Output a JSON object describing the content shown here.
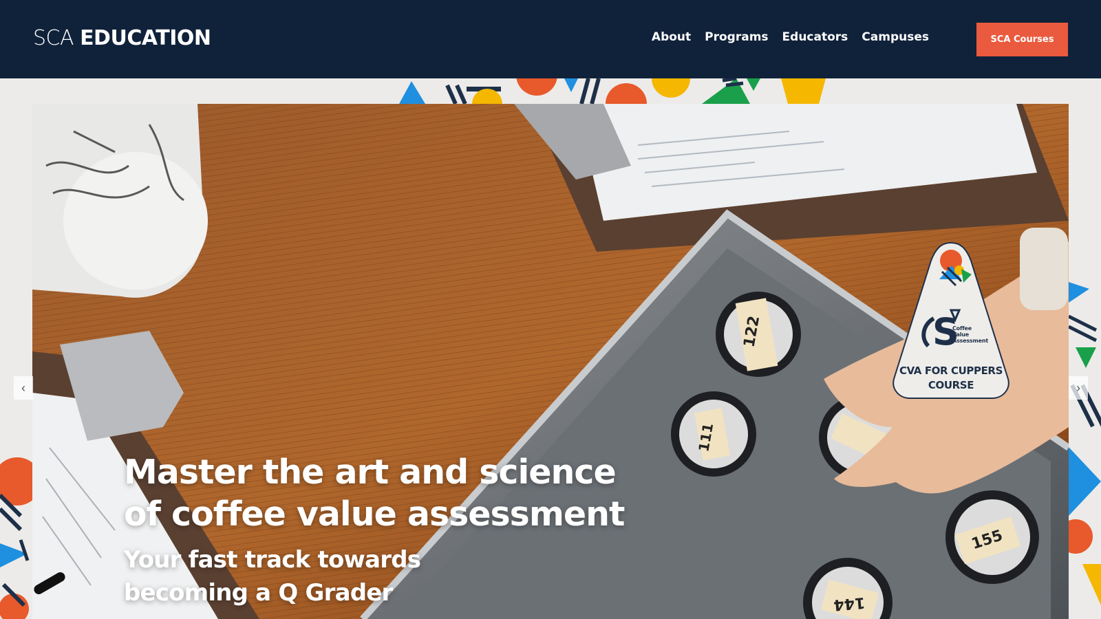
{
  "brand": {
    "logo_light": "SCA ",
    "logo_bold": "EDUCATION"
  },
  "nav": {
    "items": [
      "About",
      "Programs",
      "Educators",
      "Campuses"
    ],
    "cta_label": "SCA Courses"
  },
  "hero": {
    "headline_line1": "Master the art and science",
    "headline_line2": "of coffee value assessment",
    "subhead_line1": "Your fast track towards",
    "subhead_line2": "becoming a Q Grader",
    "badge": {
      "sub_line1": "Coffee",
      "sub_line2": "Value",
      "sub_line3": "Assessment",
      "title_line1": "CVA FOR CUPPERS",
      "title_line2": "COURSE"
    },
    "cup_labels": [
      "122",
      "111",
      "155",
      "144"
    ],
    "prev_icon": "chevron-left-icon",
    "next_icon": "chevron-right-icon"
  },
  "colors": {
    "header_bg": "#10223a",
    "cta_bg": "#ea5a3e",
    "accent_orange": "#e8592b",
    "accent_yellow": "#f5b700",
    "accent_green": "#1aa04b",
    "accent_blue": "#1f8fe0",
    "page_bg": "#ecebe9"
  }
}
